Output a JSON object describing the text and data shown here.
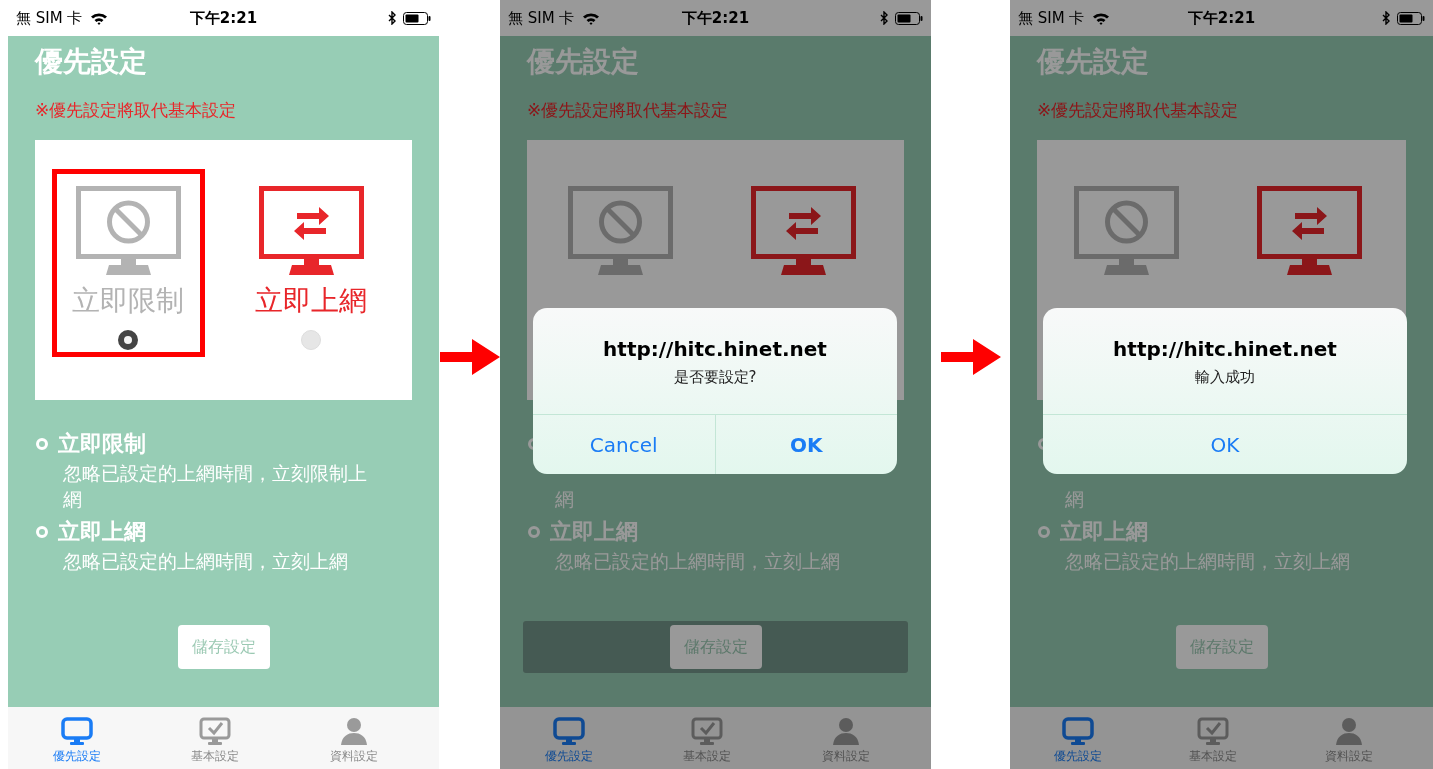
{
  "screens": [
    {
      "status_bar": {
        "carrier": "無 SIM 卡",
        "time": "下午2:21"
      },
      "title": "優先設定",
      "notice": "※優先設定將取代基本設定",
      "options": [
        {
          "kind": "block",
          "label": "立即限制",
          "selected": true
        },
        {
          "kind": "online",
          "label": "立即上網",
          "selected": false
        }
      ],
      "descriptions": [
        {
          "kind": "full",
          "heading": "立即限制",
          "text": "忽略已設定的上網時間，立刻限制上網"
        },
        {
          "kind": "full",
          "heading": "立即上網",
          "text": "忽略已設定的上網時間，立刻上網"
        }
      ],
      "save_button": {
        "label": "儲存設定",
        "highlighted": false
      },
      "tabs": [
        {
          "kind": "monitor",
          "label": "優先設定",
          "selected": true
        },
        {
          "kind": "check",
          "label": "基本設定",
          "selected": false
        },
        {
          "kind": "person",
          "label": "資料設定",
          "selected": false
        }
      ]
    },
    {
      "status_bar": {
        "carrier": "無 SIM 卡",
        "time": "下午2:21"
      },
      "title": "優先設定",
      "notice": "※優先設定將取代基本設定",
      "options": [
        {
          "kind": "block",
          "selected": false
        },
        {
          "kind": "online",
          "selected": false
        }
      ],
      "descriptions": [
        {
          "kind": "continued",
          "text": "網"
        },
        {
          "kind": "full",
          "heading": "立即上網",
          "text": "忽略已設定的上網時間，立刻上網"
        }
      ],
      "save_button": {
        "label": "儲存設定",
        "highlighted": true
      },
      "tabs": [
        {
          "kind": "monitor",
          "label": "優先設定",
          "selected": true
        },
        {
          "kind": "check",
          "label": "基本設定",
          "selected": false
        },
        {
          "kind": "person",
          "label": "資料設定",
          "selected": false
        }
      ],
      "dialog": {
        "title": "http://hitc.hinet.net",
        "message": "是否要設定?",
        "buttons": [
          {
            "label": "Cancel",
            "primary": false
          },
          {
            "label": "OK",
            "primary": true
          }
        ]
      }
    },
    {
      "status_bar": {
        "carrier": "無 SIM 卡",
        "time": "下午2:21"
      },
      "title": "優先設定",
      "notice": "※優先設定將取代基本設定",
      "options": [
        {
          "kind": "block",
          "selected": false
        },
        {
          "kind": "online",
          "selected": false
        }
      ],
      "descriptions": [
        {
          "kind": "continued",
          "text": "網"
        },
        {
          "kind": "full",
          "heading": "立即上網",
          "text": "忽略已設定的上網時間，立刻上網"
        }
      ],
      "save_button": {
        "label": "儲存設定",
        "highlighted": false
      },
      "tabs": [
        {
          "kind": "monitor",
          "label": "優先設定",
          "selected": true
        },
        {
          "kind": "check",
          "label": "基本設定",
          "selected": false
        },
        {
          "kind": "person",
          "label": "資料設定",
          "selected": false
        }
      ],
      "dialog": {
        "title": "http://hitc.hinet.net",
        "message": "輸入成功",
        "buttons": [
          {
            "label": "OK",
            "primary": false
          }
        ]
      }
    }
  ]
}
